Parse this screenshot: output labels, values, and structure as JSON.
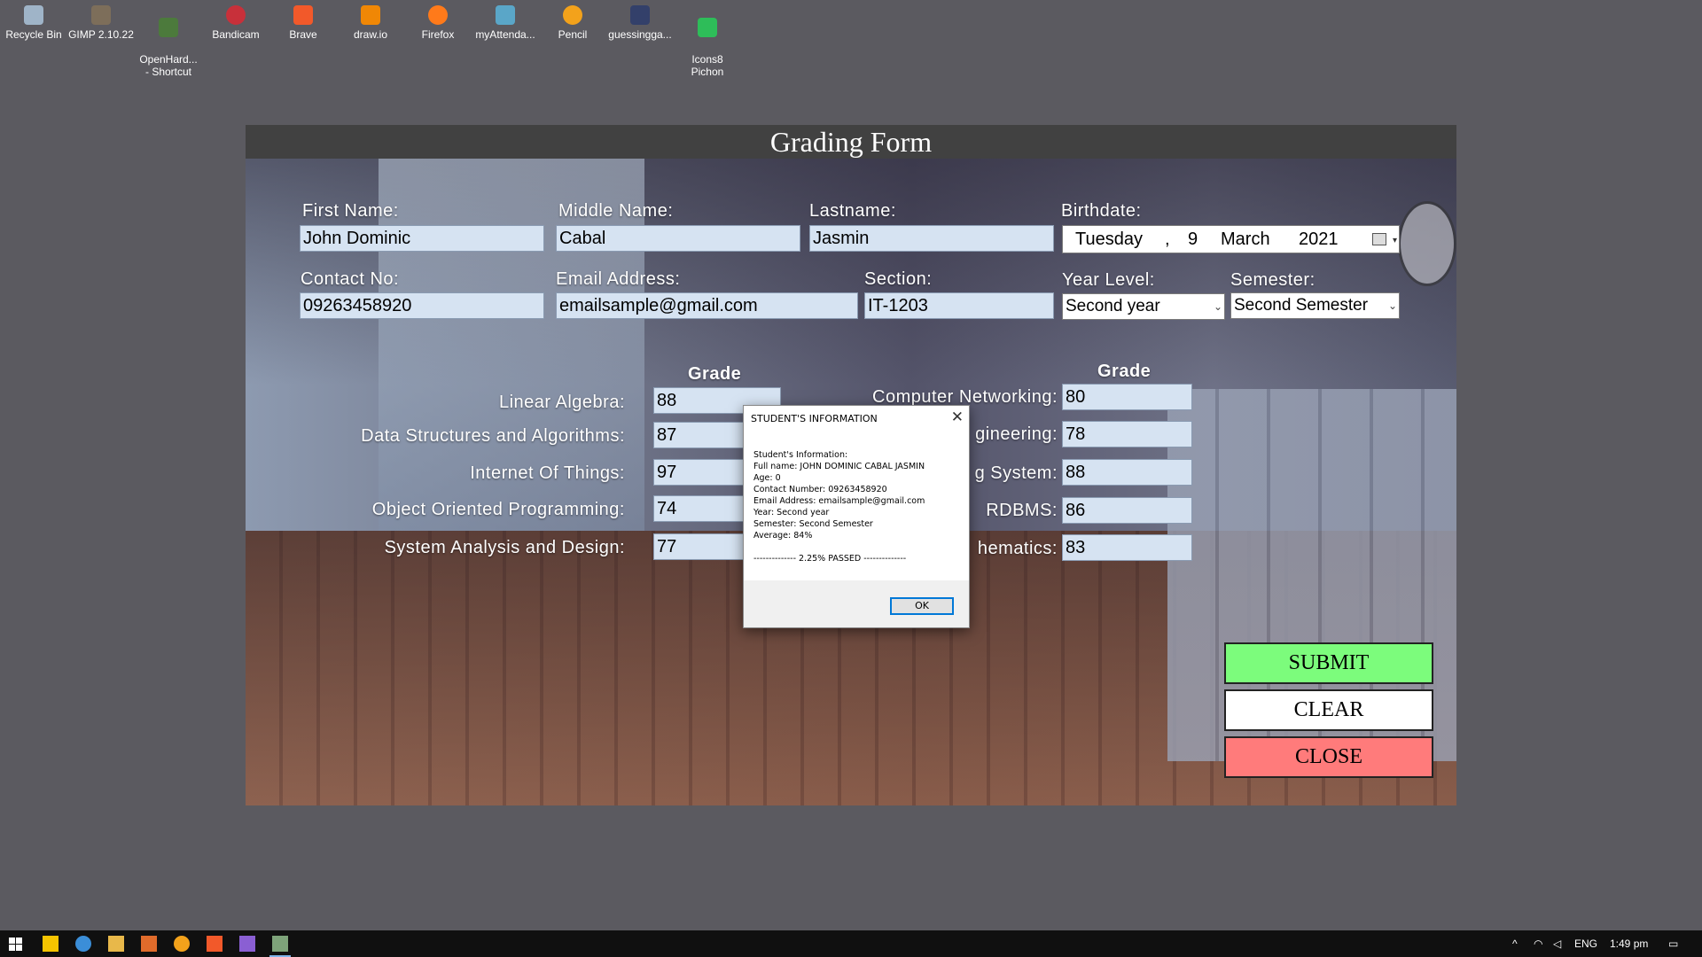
{
  "desktop": {
    "icons": [
      {
        "label": "Recycle Bin"
      },
      {
        "label": "GIMP 2.10.22"
      },
      {
        "label": "OpenHard...\n- Shortcut"
      },
      {
        "label": "Bandicam"
      },
      {
        "label": "Brave"
      },
      {
        "label": "draw.io"
      },
      {
        "label": "Firefox"
      },
      {
        "label": "myAttenda..."
      },
      {
        "label": "Pencil"
      },
      {
        "label": "guessingga..."
      },
      {
        "label": "Icons8\nPichon"
      }
    ]
  },
  "window": {
    "title": "Grading Form"
  },
  "form": {
    "first_name_label": "First Name:",
    "first_name_value": "John Dominic",
    "middle_name_label": "Middle Name:",
    "middle_name_value": "Cabal",
    "lastname_label": "Lastname:",
    "lastname_value": "Jasmin",
    "birthdate_label": "Birthdate:",
    "birthdate": {
      "weekday": "Tuesday",
      "sep": ",",
      "day": "9",
      "month": "March",
      "year": "2021"
    },
    "contact_label": "Contact No:",
    "contact_value": "09263458920",
    "email_label": "Email Address:",
    "email_value": "emailsample@gmail.com",
    "section_label": "Section:",
    "section_value": "IT-1203",
    "year_level_label": "Year Level:",
    "year_level_value": "Second year",
    "semester_label": "Semester:",
    "semester_value": "Second Semester"
  },
  "grades": {
    "left_header": "Grade",
    "right_header": "Grade",
    "left": [
      {
        "subject": "Linear Algebra:",
        "grade": "88"
      },
      {
        "subject": "Data Structures and Algorithms:",
        "grade": "87"
      },
      {
        "subject": "Internet Of Things:",
        "grade": "97"
      },
      {
        "subject": "Object Oriented Programming:",
        "grade": "74"
      },
      {
        "subject": "System Analysis and Design:",
        "grade": "77"
      }
    ],
    "right": [
      {
        "subject": "Computer Networking:",
        "grade": "80"
      },
      {
        "subject": "gineering:",
        "grade": "78"
      },
      {
        "subject": "g System:",
        "grade": "88"
      },
      {
        "subject": "RDBMS:",
        "grade": "86"
      },
      {
        "subject": "hematics:",
        "grade": "83"
      }
    ]
  },
  "buttons": {
    "submit": "SUBMIT",
    "clear": "CLEAR",
    "close": "CLOSE"
  },
  "colors": {
    "submit_bg": "#7cfc7c",
    "clear_bg": "#ffffff",
    "close_bg": "#ff7b7b"
  },
  "dialog": {
    "title": "STUDENT'S INFORMATION",
    "lines": [
      "Student's Information:",
      "Full name: JOHN DOMINIC CABAL JASMIN",
      "Age: 0",
      "Contact Number: 09263458920",
      "Email Address: emailsample@gmail.com",
      "Year: Second year",
      "Semester: Second Semester",
      "Average: 84%",
      "",
      "--------------   2.25% PASSED   --------------"
    ],
    "ok_label": "OK"
  },
  "taskbar": {
    "language": "ENG",
    "time": "1:49 pm"
  }
}
